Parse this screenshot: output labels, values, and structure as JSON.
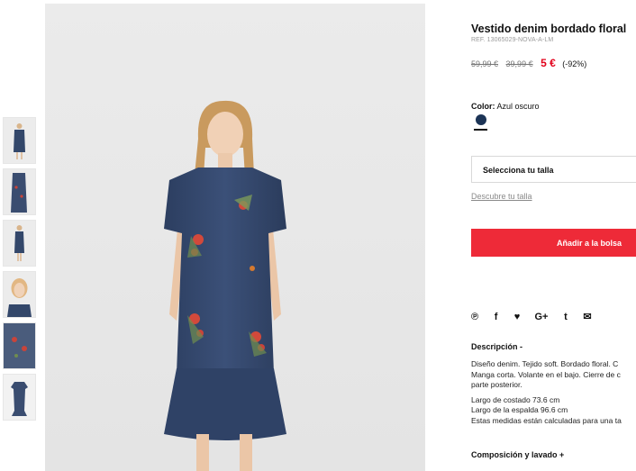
{
  "product": {
    "title": "Vestido denim bordado floral",
    "ref": "REF. 13065029-NOVA-A-LM",
    "prices": {
      "old1": "59,99 €",
      "old2": "39,99 €",
      "current": "5 €",
      "discount": "(-92%)"
    }
  },
  "color": {
    "label": "Color:",
    "value": "Azul oscuro",
    "swatch_hex": "#1c3456"
  },
  "size": {
    "select_label": "Selecciona tu talla",
    "guide_link": "Descubre tu talla"
  },
  "cart": {
    "add_label": "Añadir a la bolsa",
    "accent": "#ee2a38"
  },
  "social": {
    "icons": [
      "pinterest-icon",
      "facebook-icon",
      "twitter-icon",
      "google-plus-icon",
      "tumblr-icon",
      "email-icon"
    ],
    "glyphs": [
      "℗",
      "f",
      "♥",
      "G+",
      "t",
      "✉"
    ]
  },
  "description": {
    "heading": "Descripción -",
    "para1_line1": "Diseño denim. Tejido soft. Bordado floral. C",
    "para1_line2": "Manga corta. Volante en el bajo. Cierre de c",
    "para1_line3": "parte posterior.",
    "para2_line1": "Largo de costado 73.6 cm",
    "para2_line2": "Largo de la espalda 96.6 cm",
    "para2_line3": "Estas medidas están calculadas para una ta"
  },
  "composition": {
    "heading": "Composición y lavado +"
  },
  "gallery": {
    "thumb_count": 6
  }
}
